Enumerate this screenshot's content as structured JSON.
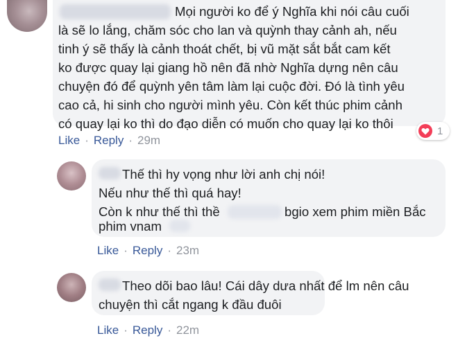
{
  "comment_main": {
    "lines": [
      "Mọi người ko để ý Nghĩa khi nói câu cuối",
      "là sẽ lo lắng, chăm sóc cho lan và quỳnh thay cảnh ah, nếu",
      "tinh ý sẽ thấy là cảnh thoát chết, bị vũ mặt sắt bắt cam kết",
      "ko được quay lại giang hồ nên đã nhờ Nghĩa dựng nên câu",
      "chuyện đó để quỳnh yên tâm làm lại cuộc đời. Đó là tình yêu",
      "cao cả, hi sinh cho người mình yêu. Còn kết thúc phim cảnh",
      "có quay lại ko thì do đạo diễn có muốn cho quay lại ko thôi"
    ],
    "like_label": "Like",
    "separator": "·",
    "reply_label": "Reply",
    "timestamp": "29m",
    "reaction_count": "1",
    "reaction_icon": "heart-icon",
    "reaction_color": "#f33e58"
  },
  "reply_1": {
    "lines": [
      "Thế thì hy vọng như lời anh chị nói!",
      "Nếu như thế thì quá hay!",
      "Còn k như thế thì thề",
      "bgio xem phim miền Bắc",
      "phim vnam"
    ],
    "like_label": "Like",
    "separator": "·",
    "reply_label": "Reply",
    "timestamp": "23m"
  },
  "reply_2": {
    "lines": [
      "Theo dõi bao lâu! Cái dây dưa nhất để lm nên câu",
      "chuyện thì cắt ngang k đầu đuôi"
    ],
    "like_label": "Like",
    "separator": "·",
    "reply_label": "Reply",
    "timestamp": "22m"
  },
  "colors": {
    "link": "#385898",
    "bubble_bg": "#f2f3f5",
    "text": "#1c1e21",
    "meta": "#90949c"
  }
}
